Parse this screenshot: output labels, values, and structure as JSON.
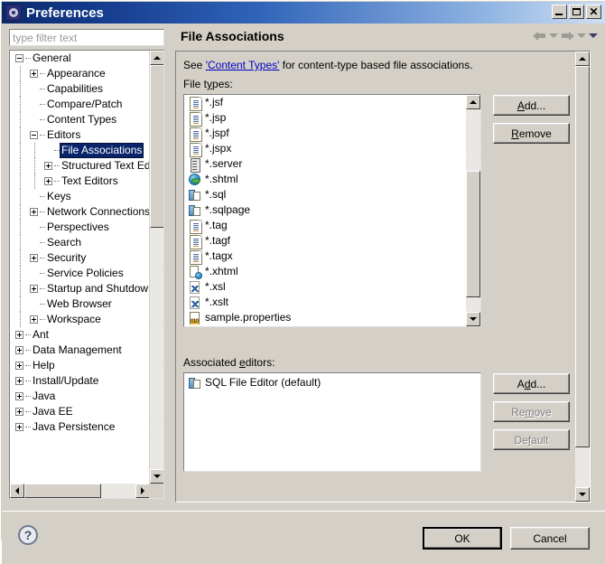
{
  "window": {
    "title": "Preferences",
    "icon": "preferences-gear-icon",
    "controls": {
      "minimize": "–",
      "maximize": "□",
      "close": "✕"
    }
  },
  "sidebar": {
    "filter": {
      "placeholder": "type filter text",
      "value": ""
    },
    "tree": [
      {
        "label": "General",
        "depth": 0,
        "expander": "minus",
        "selected": false
      },
      {
        "label": "Appearance",
        "depth": 1,
        "expander": "plus",
        "selected": false
      },
      {
        "label": "Capabilities",
        "depth": 1,
        "expander": "none",
        "selected": false
      },
      {
        "label": "Compare/Patch",
        "depth": 1,
        "expander": "none",
        "selected": false
      },
      {
        "label": "Content Types",
        "depth": 1,
        "expander": "none",
        "selected": false
      },
      {
        "label": "Editors",
        "depth": 1,
        "expander": "minus",
        "selected": false
      },
      {
        "label": "File Associations",
        "depth": 2,
        "expander": "none",
        "selected": true
      },
      {
        "label": "Structured Text Editors",
        "depth": 2,
        "expander": "plus",
        "selected": false
      },
      {
        "label": "Text Editors",
        "depth": 2,
        "expander": "plus",
        "selected": false
      },
      {
        "label": "Keys",
        "depth": 1,
        "expander": "none",
        "selected": false
      },
      {
        "label": "Network Connections",
        "depth": 1,
        "expander": "plus",
        "selected": false
      },
      {
        "label": "Perspectives",
        "depth": 1,
        "expander": "none",
        "selected": false
      },
      {
        "label": "Search",
        "depth": 1,
        "expander": "none",
        "selected": false
      },
      {
        "label": "Security",
        "depth": 1,
        "expander": "plus",
        "selected": false
      },
      {
        "label": "Service Policies",
        "depth": 1,
        "expander": "none",
        "selected": false
      },
      {
        "label": "Startup and Shutdown",
        "depth": 1,
        "expander": "plus",
        "selected": false
      },
      {
        "label": "Web Browser",
        "depth": 1,
        "expander": "none",
        "selected": false
      },
      {
        "label": "Workspace",
        "depth": 1,
        "expander": "plus",
        "selected": false
      },
      {
        "label": "Ant",
        "depth": 0,
        "expander": "plus",
        "selected": false
      },
      {
        "label": "Data Management",
        "depth": 0,
        "expander": "plus",
        "selected": false
      },
      {
        "label": "Help",
        "depth": 0,
        "expander": "plus",
        "selected": false
      },
      {
        "label": "Install/Update",
        "depth": 0,
        "expander": "plus",
        "selected": false
      },
      {
        "label": "Java",
        "depth": 0,
        "expander": "plus",
        "selected": false
      },
      {
        "label": "Java EE",
        "depth": 0,
        "expander": "plus",
        "selected": false
      },
      {
        "label": "Java Persistence",
        "depth": 0,
        "expander": "plus",
        "selected": false
      }
    ]
  },
  "page": {
    "title": "File Associations",
    "nav": {
      "back": "back-arrow",
      "back_menu": "caret-down",
      "forward": "forward-arrow",
      "forward_menu": "caret-down",
      "view_menu": "caret-down"
    },
    "description": {
      "prefix": "See ",
      "link": "'Content Types'",
      "suffix": " for content-type based file associations."
    },
    "file_types_label_pre": "File t",
    "file_types_label_mnemonic": "y",
    "file_types_label_post": "pes:",
    "file_types": [
      {
        "name": "*.jsf",
        "icon": "doc-icon"
      },
      {
        "name": "*.jsp",
        "icon": "doc-icon"
      },
      {
        "name": "*.jspf",
        "icon": "doc-icon"
      },
      {
        "name": "*.jspx",
        "icon": "doc-icon"
      },
      {
        "name": "*.server",
        "icon": "server-icon"
      },
      {
        "name": "*.shtml",
        "icon": "globe-icon"
      },
      {
        "name": "*.sql",
        "icon": "sql-icon"
      },
      {
        "name": "*.sqlpage",
        "icon": "sql-icon"
      },
      {
        "name": "*.tag",
        "icon": "doc-icon"
      },
      {
        "name": "*.tagf",
        "icon": "doc-icon"
      },
      {
        "name": "*.tagx",
        "icon": "doc-icon"
      },
      {
        "name": "*.xhtml",
        "icon": "xhtml-icon"
      },
      {
        "name": "*.xsl",
        "icon": "xsl-icon"
      },
      {
        "name": "*.xslt",
        "icon": "xsl-icon"
      },
      {
        "name": "sample.properties",
        "icon": "properties-icon"
      }
    ],
    "file_type_buttons": [
      {
        "label": "Add...",
        "mnemonic": "A",
        "disabled": false,
        "name": "add-file-type-button"
      },
      {
        "label": "Remove",
        "mnemonic": "R",
        "disabled": false,
        "name": "remove-file-type-button"
      }
    ],
    "associated_editors_label_pre": "Associated ",
    "associated_editors_label_mnemonic": "e",
    "associated_editors_label_post": "ditors:",
    "associated_editors": [
      {
        "name": "SQL File Editor (default)",
        "icon": "sql-icon"
      }
    ],
    "editor_buttons": [
      {
        "label": "Add...",
        "mnemonic": "d",
        "disabled": false,
        "name": "add-editor-button"
      },
      {
        "label": "Remove",
        "mnemonic": "m",
        "disabled": true,
        "name": "remove-editor-button"
      },
      {
        "label": "Default",
        "mnemonic": "f",
        "disabled": true,
        "name": "default-editor-button"
      }
    ]
  },
  "footer": {
    "help": "?",
    "ok": "OK",
    "cancel": "Cancel"
  }
}
